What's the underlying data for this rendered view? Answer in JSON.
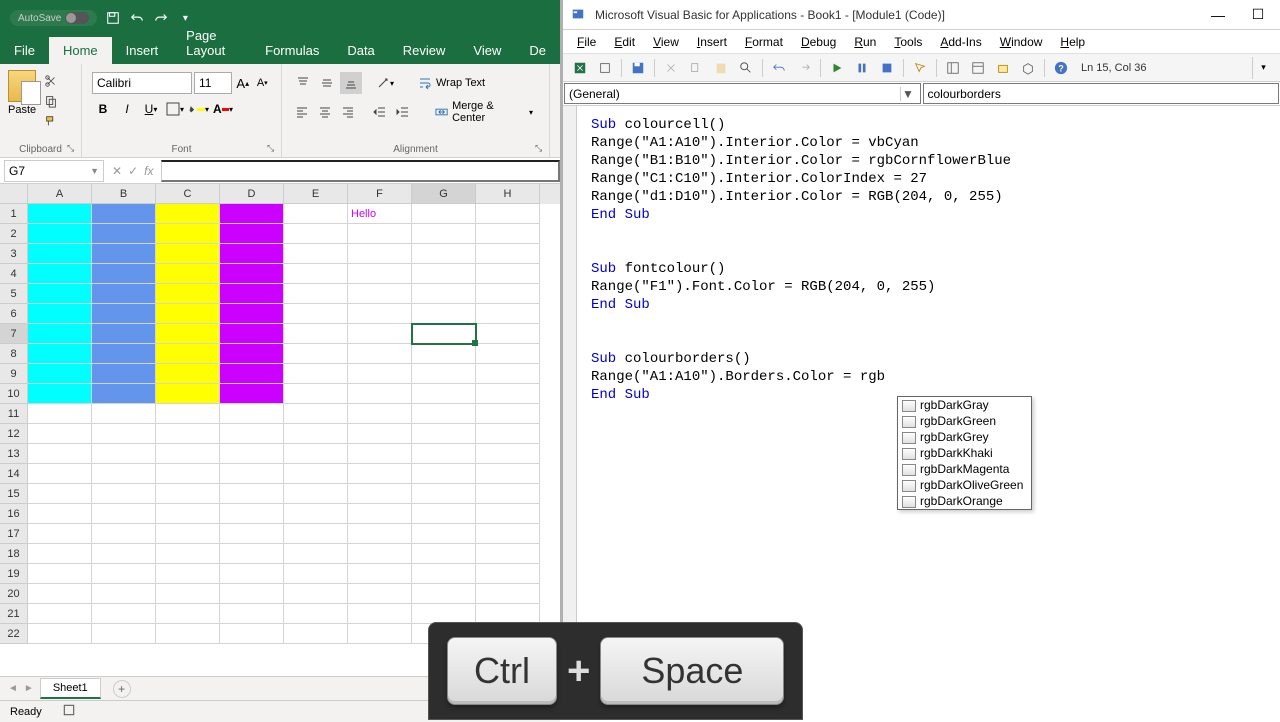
{
  "excel": {
    "autosave_label": "AutoSave",
    "tabs": [
      "File",
      "Home",
      "Insert",
      "Page Layout",
      "Formulas",
      "Data",
      "Review",
      "View",
      "De"
    ],
    "active_tab": "Home",
    "clipboard_label": "Clipboard",
    "paste_label": "Paste",
    "font_label": "Font",
    "font_name": "Calibri",
    "font_size": "11",
    "alignment_label": "Alignment",
    "wrap_label": "Wrap Text",
    "merge_label": "Merge & Center",
    "name_box": "G7",
    "formula_value": "",
    "columns": [
      "A",
      "B",
      "C",
      "D",
      "E",
      "F",
      "G",
      "H"
    ],
    "active_col": "G",
    "rows": [
      1,
      2,
      3,
      4,
      5,
      6,
      7,
      8,
      9,
      10,
      11,
      12,
      13,
      14,
      15,
      16,
      17,
      18,
      19,
      20,
      21,
      22
    ],
    "active_row": 7,
    "cell_F1": "Hello",
    "col_colors": {
      "A": "#00FFFF",
      "B": "#6495ED",
      "C": "#FFFF00",
      "D": "#CC00FF"
    },
    "sheet_name": "Sheet1",
    "status": "Ready"
  },
  "vba": {
    "title": "Microsoft Visual Basic for Applications - Book1 - [Module1 (Code)]",
    "menus": [
      "File",
      "Edit",
      "View",
      "Insert",
      "Format",
      "Debug",
      "Run",
      "Tools",
      "Add-Ins",
      "Window",
      "Help"
    ],
    "cursor_pos": "Ln 15, Col 36",
    "dd_left": "(General)",
    "dd_right": "colourborders",
    "code_lines": [
      {
        "t": "Sub colourcell()",
        "kw": [
          0,
          3
        ]
      },
      {
        "t": "Range(\"A1:A10\").Interior.Color = vbCyan"
      },
      {
        "t": "Range(\"B1:B10\").Interior.Color = rgbCornflowerBlue"
      },
      {
        "t": "Range(\"C1:C10\").Interior.ColorIndex = 27"
      },
      {
        "t": "Range(\"d1:D10\").Interior.Color = RGB(204, 0, 255)"
      },
      {
        "t": "End Sub",
        "kw": [
          0,
          7
        ]
      },
      {
        "t": ""
      },
      {
        "t": ""
      },
      {
        "t": "Sub fontcolour()",
        "kw": [
          0,
          3
        ]
      },
      {
        "t": "Range(\"F1\").Font.Color = RGB(204, 0, 255)"
      },
      {
        "t": "End Sub",
        "kw": [
          0,
          7
        ]
      },
      {
        "t": ""
      },
      {
        "t": ""
      },
      {
        "t": "Sub colourborders()",
        "kw": [
          0,
          3
        ]
      },
      {
        "t": "Range(\"A1:A10\").Borders.Color = rgb"
      },
      {
        "t": "End Sub",
        "kw": [
          0,
          7
        ]
      }
    ],
    "intellisense": [
      "rgbDarkGray",
      "rgbDarkGreen",
      "rgbDarkGrey",
      "rgbDarkKhaki",
      "rgbDarkMagenta",
      "rgbDarkOliveGreen",
      "rgbDarkOrange"
    ]
  },
  "keys": {
    "k1": "Ctrl",
    "plus": "+",
    "k2": "Space"
  }
}
